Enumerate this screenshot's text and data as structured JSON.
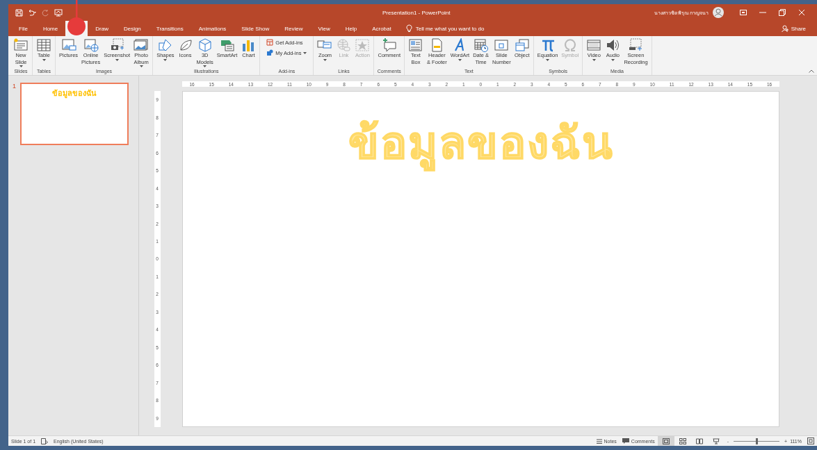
{
  "window": {
    "title": "Presentation1  -  PowerPoint",
    "user": "นางสาวชิดพิรุณ กาญจนา"
  },
  "quick_access": [
    {
      "kind": "save",
      "disabled": false
    },
    {
      "kind": "undo",
      "disabled": false
    },
    {
      "kind": "redo",
      "disabled": true
    },
    {
      "kind": "present",
      "disabled": false
    }
  ],
  "tabs": [
    {
      "label": "File",
      "selected": false
    },
    {
      "label": "Home",
      "selected": false
    },
    {
      "selected": true
    },
    {
      "label": "Draw",
      "selected": false
    },
    {
      "label": "Design",
      "selected": false
    },
    {
      "label": "Transitions",
      "selected": false
    },
    {
      "label": "Animations",
      "selected": false
    },
    {
      "label": "Slide Show",
      "selected": false
    },
    {
      "label": "Review",
      "selected": false
    },
    {
      "label": "View",
      "selected": false
    },
    {
      "label": "Help",
      "selected": false
    },
    {
      "label": "Acrobat",
      "selected": false
    }
  ],
  "tell_me": {
    "placeholder": "Tell me what you want to do"
  },
  "share": "Share",
  "ribbon": [
    {
      "label": "Slides",
      "items": [
        {
          "kind": "big",
          "lines": [
            "New",
            "Slide"
          ],
          "dropdown": true,
          "disabled": false
        }
      ]
    },
    {
      "label": "Tables",
      "items": [
        {
          "kind": "big",
          "lines": [
            "Table"
          ],
          "dropdown": true,
          "disabled": false
        }
      ]
    },
    {
      "label": "Images",
      "items": [
        {
          "kind": "big",
          "lines": [
            "Pictures"
          ],
          "dropdown": false,
          "disabled": false
        },
        {
          "kind": "big",
          "lines": [
            "Online",
            "Pictures"
          ],
          "dropdown": false,
          "disabled": false
        },
        {
          "kind": "big",
          "lines": [
            "Screenshot"
          ],
          "dropdown": true,
          "disabled": false
        },
        {
          "kind": "big",
          "lines": [
            "Photo",
            "Album"
          ],
          "dropdown": true,
          "disabled": false
        }
      ]
    },
    {
      "label": "Illustrations",
      "items": [
        {
          "kind": "big",
          "lines": [
            "Shapes"
          ],
          "dropdown": true,
          "disabled": false
        },
        {
          "kind": "big",
          "lines": [
            "Icons"
          ],
          "dropdown": false,
          "disabled": false
        },
        {
          "kind": "big",
          "lines": [
            "3D",
            "Models"
          ],
          "dropdown": true,
          "disabled": false
        },
        {
          "kind": "big",
          "lines": [
            "SmartArt"
          ],
          "dropdown": false,
          "disabled": false
        },
        {
          "kind": "big",
          "lines": [
            "Chart"
          ],
          "dropdown": false,
          "disabled": false
        }
      ]
    },
    {
      "label": "Add-ins",
      "items": [
        {
          "kind": "row",
          "lines": [
            "Get Add-ins"
          ],
          "dropdown": false,
          "disabled": false
        },
        {
          "kind": "row",
          "lines": [
            "My Add-ins"
          ],
          "dropdown": true,
          "disabled": false
        }
      ]
    },
    {
      "label": "Links",
      "items": [
        {
          "kind": "big",
          "lines": [
            "Zoom"
          ],
          "dropdown": true,
          "disabled": false
        },
        {
          "kind": "big",
          "lines": [
            "Link"
          ],
          "dropdown": false,
          "disabled": true
        },
        {
          "kind": "big",
          "lines": [
            "Action"
          ],
          "dropdown": false,
          "disabled": true
        }
      ]
    },
    {
      "label": "Comments",
      "items": [
        {
          "kind": "big",
          "lines": [
            "Comment"
          ],
          "dropdown": false,
          "disabled": false
        }
      ]
    },
    {
      "label": "Text",
      "items": [
        {
          "kind": "big",
          "lines": [
            "Text",
            "Box"
          ],
          "dropdown": false,
          "disabled": false
        },
        {
          "kind": "big",
          "lines": [
            "Header",
            "& Footer"
          ],
          "dropdown": false,
          "disabled": false
        },
        {
          "kind": "big",
          "lines": [
            "WordArt"
          ],
          "dropdown": true,
          "disabled": false
        },
        {
          "kind": "big",
          "lines": [
            "Date &",
            "Time"
          ],
          "dropdown": false,
          "disabled": false
        },
        {
          "kind": "big",
          "lines": [
            "Slide",
            "Number"
          ],
          "dropdown": false,
          "disabled": false
        },
        {
          "kind": "big",
          "lines": [
            "Object"
          ],
          "dropdown": false,
          "disabled": false
        }
      ]
    },
    {
      "label": "Symbols",
      "items": [
        {
          "kind": "big",
          "lines": [
            "Equation"
          ],
          "dropdown": true,
          "disabled": false
        },
        {
          "kind": "big",
          "lines": [
            "Symbol"
          ],
          "dropdown": false,
          "disabled": true
        }
      ]
    },
    {
      "label": "Media",
      "items": [
        {
          "kind": "big",
          "lines": [
            "Video"
          ],
          "dropdown": true,
          "disabled": false
        },
        {
          "kind": "big",
          "lines": [
            "Audio"
          ],
          "dropdown": true,
          "disabled": false
        },
        {
          "kind": "big",
          "lines": [
            "Screen",
            "Recording"
          ],
          "dropdown": false,
          "disabled": false
        }
      ]
    }
  ],
  "thumbnails": [
    {
      "number": "1",
      "title": "ข้อมูลของฉัน",
      "selected": true
    }
  ],
  "ruler_horizontal": [
    "16",
    "15",
    "14",
    "13",
    "12",
    "11",
    "10",
    "9",
    "8",
    "7",
    "6",
    "5",
    "4",
    "3",
    "2",
    "1",
    "0",
    "1",
    "2",
    "3",
    "4",
    "5",
    "6",
    "7",
    "8",
    "9",
    "10",
    "11",
    "12",
    "13",
    "14",
    "15",
    "16"
  ],
  "ruler_vertical": [
    "9",
    "8",
    "7",
    "6",
    "5",
    "4",
    "3",
    "2",
    "1",
    "0",
    "1",
    "2",
    "3",
    "4",
    "5",
    "6",
    "7",
    "8",
    "9"
  ],
  "slide": {
    "title": "ข้อมูลของฉัน"
  },
  "status_bar": {
    "slide": "Slide 1 of 1",
    "language": "English (United States)",
    "notes": "Notes",
    "comments": "Comments",
    "views": [
      {
        "kind": "normal",
        "selected": true
      },
      {
        "kind": "sorter",
        "selected": false
      },
      {
        "kind": "reading",
        "selected": false
      },
      {
        "kind": "show",
        "selected": false
      }
    ],
    "zoom_minus": "-",
    "zoom_plus": "+",
    "zoom": {
      "level": 0.5
    },
    "zoom_reading": "111%"
  }
}
